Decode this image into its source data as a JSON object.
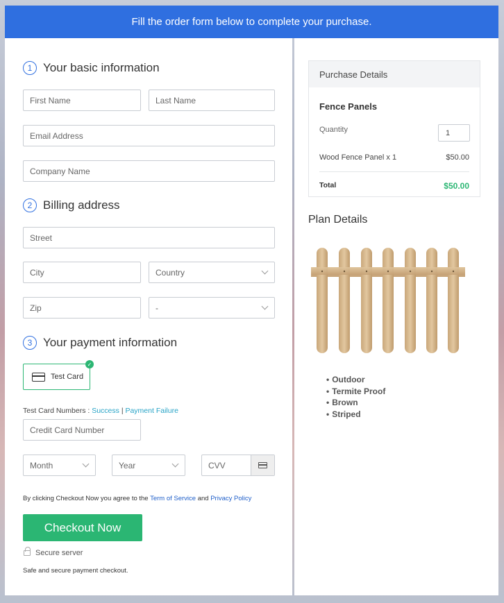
{
  "banner": {
    "text": "Fill the order form below to complete your purchase."
  },
  "basic_info": {
    "step": "1",
    "title": "Your basic information",
    "first_name": "First Name",
    "last_name": "Last Name",
    "email": "Email Address",
    "company": "Company Name"
  },
  "billing": {
    "step": "2",
    "title": "Billing address",
    "street": "Street",
    "city": "City",
    "country": "Country",
    "zip": "Zip",
    "state": "-"
  },
  "payment": {
    "step": "3",
    "title": "Your payment information",
    "card_option": "Test Card",
    "test_numbers_label": "Test Card Numbers :",
    "success_link": "Success",
    "separator": "|",
    "failure_link": "Payment Failure",
    "card_number": "Credit Card Number",
    "month": "Month",
    "year": "Year",
    "cvv": "CVV"
  },
  "agreement": {
    "prefix": "By clicking Checkout Now you agree to the",
    "terms": "Term of Service",
    "and": "and",
    "privacy": "Privacy Policy"
  },
  "checkout_button": "Checkout Now",
  "secure_server": "Secure server",
  "secure_note": "Safe and secure payment checkout.",
  "purchase": {
    "header": "Purchase Details",
    "product": "Fence Panels",
    "quantity_label": "Quantity",
    "quantity_value": "1",
    "line_item": "Wood Fence Panel x 1",
    "line_price": "$50.00",
    "total_label": "Total",
    "total_value": "$50.00"
  },
  "plan": {
    "title": "Plan Details",
    "features": [
      "Outdoor",
      "Termite Proof",
      "Brown",
      "Striped"
    ]
  },
  "colors": {
    "brand_blue": "#2f6fe0",
    "success_green": "#2bb673",
    "link_teal": "#26a3c6"
  }
}
